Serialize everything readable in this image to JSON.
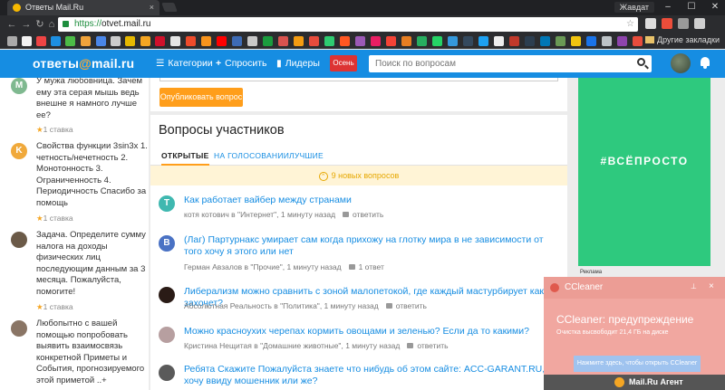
{
  "browser": {
    "tab_title": "Ответы Mail.Ru",
    "tab_close": "×",
    "profile_name": "Жавдат",
    "url_scheme": "https://",
    "url_host": "otvet.mail.ru",
    "other_bookmarks": "Другие закладки",
    "window_controls": [
      "–",
      "☐",
      "✕"
    ],
    "nav_icons": [
      "back-icon",
      "forward-icon",
      "reload-icon",
      "home-icon"
    ]
  },
  "header": {
    "logo_left": "ответы",
    "logo_at": "@",
    "logo_right": "mail.ru",
    "nav": [
      {
        "label": "Категории",
        "icon": "☰"
      },
      {
        "label": "Спросить",
        "icon": "+"
      },
      {
        "label": "Лидеры",
        "icon": "▮"
      }
    ],
    "season_label": "Осень",
    "search_placeholder": "Поиск по вопросам"
  },
  "sidebar": {
    "items": [
      {
        "letter": "M",
        "color": "#7fb990",
        "text": "У мужа любовница. Зачем ему эта серая мышь ведь внешне я намного лучше ее?",
        "bet": "1 ставка"
      },
      {
        "letter": "K",
        "color": "#f0a93b",
        "text": "Свойства функции 3sin3x 1. четность/нечетность 2. Монотонность 3. Ограниченность 4. Периодичность Спасибо за помощь",
        "bet": "1 ставка"
      },
      {
        "letter": "",
        "color": "#6b5a48",
        "text": "Задача. Определите сумму налога на доходы физических лиц последующим данным за 3 месяца. Пожалуйста, помогите!",
        "bet": "1 ставка"
      },
      {
        "letter": "",
        "color": "#8a7565",
        "text": "Любопытно с вашей помощью попробовать выявить взаимосвязь конкретной Приметы и События, прогнозируемого этой приметой ..+",
        "bet": ""
      }
    ]
  },
  "main": {
    "publish_label": "Опубликовать вопрос",
    "section_title": "Вопросы участников",
    "tabs": [
      "ОТКРЫТЫЕ",
      "НА ГОЛОСОВАНИИ",
      "ЛУЧШИЕ"
    ],
    "new_questions": "9 новых вопросов",
    "questions": [
      {
        "letter": "T",
        "color": "#3fb8b0",
        "title": "Как работает вайбер между странами",
        "author": "котя котович",
        "category": "в \"Интернет\"",
        "time": "1 минуту назад",
        "answers": "ответить"
      },
      {
        "letter": "B",
        "color": "#4a72c4",
        "title": "(Лаг) Партурнакс умирает сам когда прихожу на глотку мира в не зависимости от того хочу я этого или нет",
        "author": "Герман Авзалов",
        "category": "в \"Прочие\"",
        "time": "1 минуту назад",
        "answers": "1 ответ"
      },
      {
        "letter": "",
        "color": "#2a1b16",
        "title": "Либерализм можно сравнить с зоной малопетокой, где каждый мастурбирует как захочет?",
        "author": "Абсолютная Реальность",
        "category": "в \"Политика\"",
        "time": "1 минуту назад",
        "answers": "ответить"
      },
      {
        "letter": "",
        "color": "#b79fa0",
        "title": "Можно красноухих черепах кормить овощами и зеленью? Если да то какими?",
        "author": "Кристина Нещитая",
        "category": "в \"Домашние животные\"",
        "time": "1 минуту назад",
        "answers": "ответить"
      },
      {
        "letter": "",
        "color": "#5a5a5a",
        "title": "Ребята Скажите Пожалуйста знаете что нибудь об этом сайте: ACC-GARANT.RU, Я хочу ввиду мошенник или же?",
        "author": "",
        "category": "",
        "time": "",
        "answers": ""
      }
    ]
  },
  "ad": {
    "text": "#ВСЁПРОСТО",
    "label": "Реклама"
  },
  "toast": {
    "app": "CCleaner",
    "title": "CCleaner: предупреждение",
    "body": "Очистка высвободит 21,4 ГБ на диске",
    "button": "Нажмите здесь, чтобы открыть CCleaner",
    "pin": "⊥",
    "close": "×",
    "footer": "Mail.Ru Агент"
  }
}
